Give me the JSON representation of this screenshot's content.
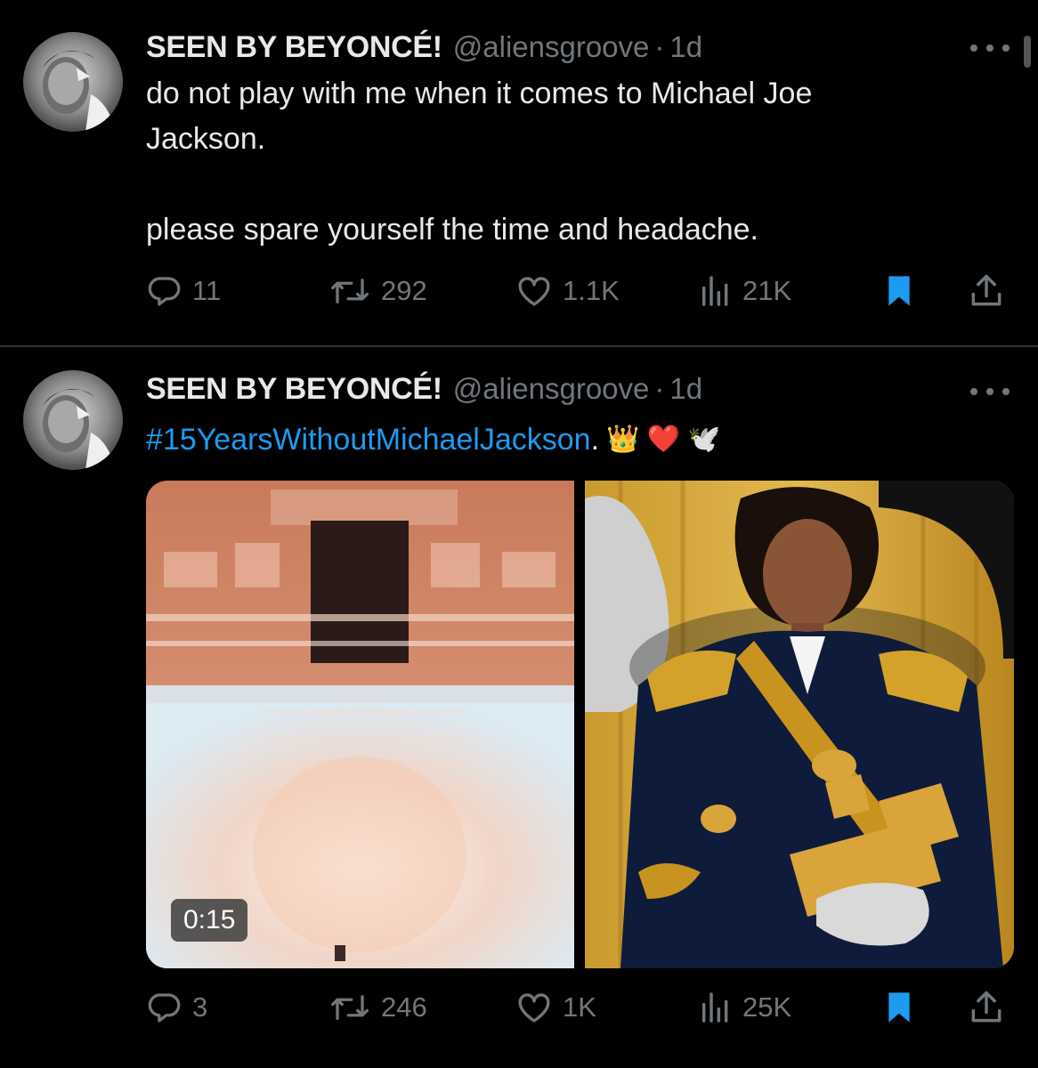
{
  "colors": {
    "background": "#000000",
    "text": "#e7e9ea",
    "muted": "#71767b",
    "accent": "#1d9bf0",
    "divider": "#2f3336"
  },
  "tweets": [
    {
      "author_name": "SEEN BY BEYONCÉ!",
      "handle": "@aliensgroove",
      "separator": "·",
      "time": "1d",
      "text": "do not play with me when it comes to Michael Joe\nJackson.\n\nplease spare yourself the time and headache.",
      "replies": "11",
      "reposts": "292",
      "likes": "1.1K",
      "views": "21K",
      "bookmarked": true,
      "icons": [
        "reply-icon",
        "repost-icon",
        "like-icon",
        "views-icon",
        "bookmark-icon",
        "share-icon",
        "more-icon"
      ]
    },
    {
      "author_name": "SEEN BY BEYONCÉ!",
      "handle": "@aliensgroove",
      "separator": "·",
      "time": "1d",
      "hashtag": "#15YearsWithoutMichaelJackson",
      "text_suffix": ".",
      "emojis": "👑 ❤️ 🕊️",
      "video_duration": "0:15",
      "replies": "3",
      "reposts": "246",
      "likes": "1K",
      "views": "25K",
      "bookmarked": true,
      "icons": [
        "reply-icon",
        "repost-icon",
        "like-icon",
        "views-icon",
        "bookmark-icon",
        "share-icon",
        "more-icon"
      ]
    }
  ]
}
